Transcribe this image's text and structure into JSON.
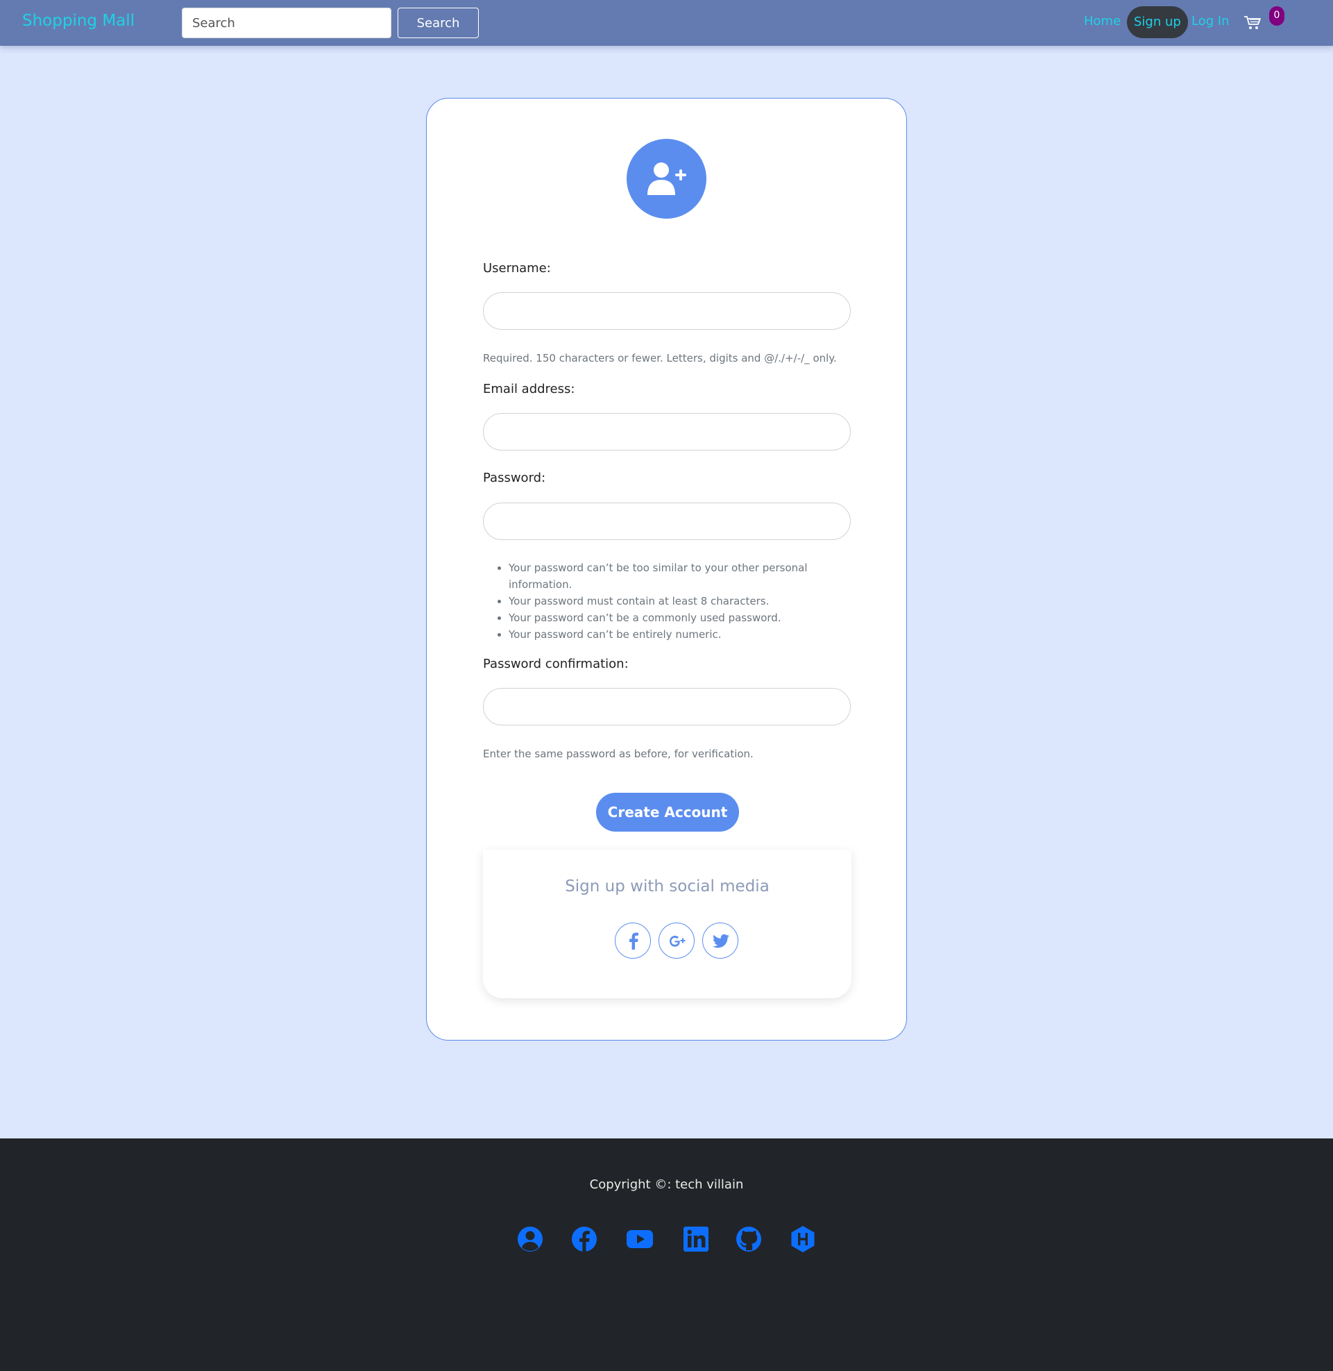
{
  "navbar": {
    "brand": "Shopping Mall",
    "search_placeholder": "Search",
    "search_button": "Search",
    "links": {
      "home": "Home",
      "signup": "Sign up",
      "login": "Log In"
    },
    "cart_icon": "shopping-cart-icon",
    "cart_count": "0"
  },
  "form": {
    "avatar_icon": "user-plus-icon",
    "username_label": "Username:",
    "username_help": "Required. 150 characters or fewer. Letters, digits and @/./+/-/_ only.",
    "email_label": "Email address:",
    "password_label": "Password:",
    "password_rules": [
      "Your password can’t be too similar to your other personal information.",
      "Your password must contain at least 8 characters.",
      "Your password can’t be a commonly used password.",
      "Your password can’t be entirely numeric."
    ],
    "password_confirm_label": "Password confirmation:",
    "password_confirm_help": "Enter the same password as before, for verification.",
    "submit_label": "Create Account"
  },
  "social": {
    "title": "Sign up with social media",
    "icons": [
      "facebook-icon",
      "google-plus-icon",
      "twitter-icon"
    ]
  },
  "footer": {
    "copyright": "Copyright ©: tech villain",
    "icons": [
      "user-circle-icon",
      "facebook-icon",
      "youtube-icon",
      "linkedin-icon",
      "github-icon",
      "hackerrank-icon"
    ]
  },
  "colors": {
    "navbar_bg": "#647bb1",
    "brand_link": "#1fd1e6",
    "page_bg": "#dce6fd",
    "accent": "#5b8def",
    "card_border": "#5b8ce6",
    "badge": "#80007f",
    "footer_bg": "#212529",
    "footer_icons": "#0d6efd"
  }
}
